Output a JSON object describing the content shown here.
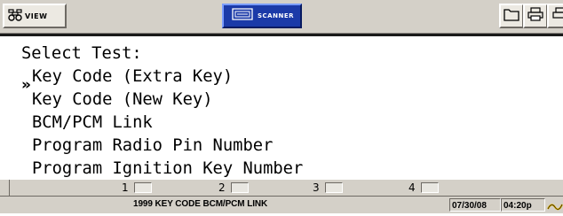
{
  "toolbar": {
    "view_label": "VIEW",
    "scanner_label": "SCANNER",
    "icons": [
      "binoculars-icon",
      "scanner-icon",
      "folder-icon",
      "printer-icon",
      "printer-icon"
    ]
  },
  "screen": {
    "heading": "Select Test:",
    "pointer": "»",
    "selected_index": 0,
    "items": [
      "Key Code (Extra Key)",
      "Key Code (New Key)",
      "BCM/PCM Link",
      "Program Radio Pin Number",
      "Program Ignition Key Number"
    ]
  },
  "tabs": [
    "1",
    "2",
    "3",
    "4"
  ],
  "status": {
    "text": "1999 KEY CODE  BCM/PCM LINK",
    "date": "07/30/08",
    "time": "04:20p"
  },
  "colors": {
    "toolbar": "#d4d0c8",
    "scanner_button": "#1b3aa8",
    "screen_bg": "#ffffff",
    "signal_icon": "#e0b000"
  }
}
